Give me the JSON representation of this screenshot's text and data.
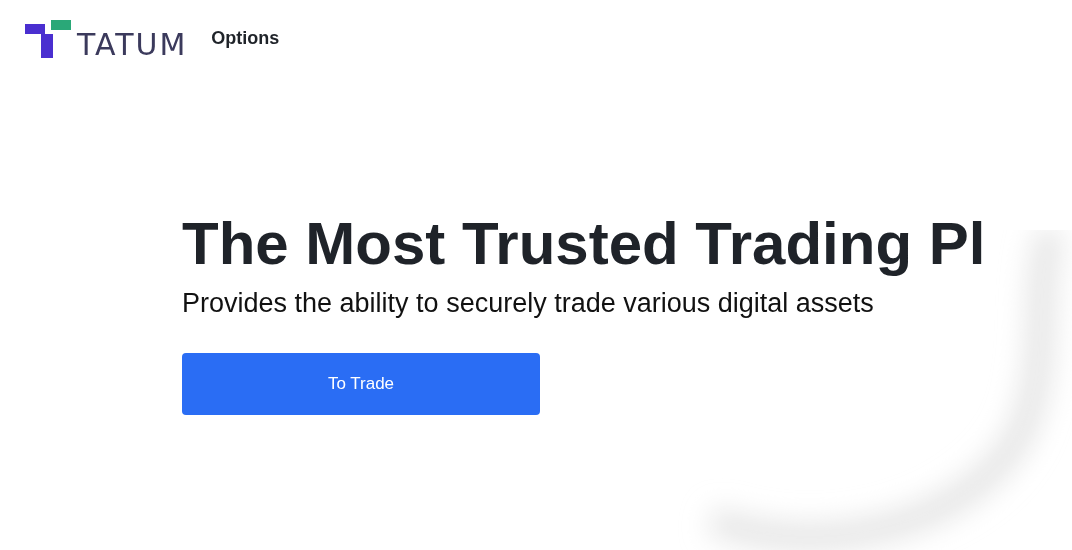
{
  "header": {
    "logo_text": "TATUM",
    "nav": [
      {
        "label": "Options"
      }
    ]
  },
  "hero": {
    "title": "The Most Trusted Trading Pl",
    "subtitle": "Provides the ability to securely trade various digital assets",
    "button": "To Trade"
  }
}
